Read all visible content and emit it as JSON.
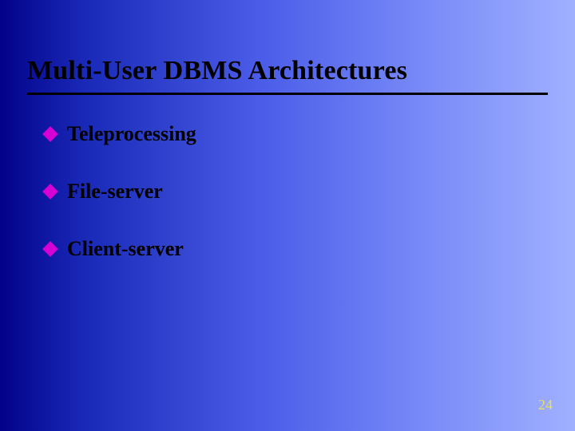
{
  "title": "Multi-User DBMS Architectures",
  "bullets": {
    "0": "Teleprocessing",
    "1": "File-server",
    "2": "Client-server"
  },
  "page_number": "24"
}
